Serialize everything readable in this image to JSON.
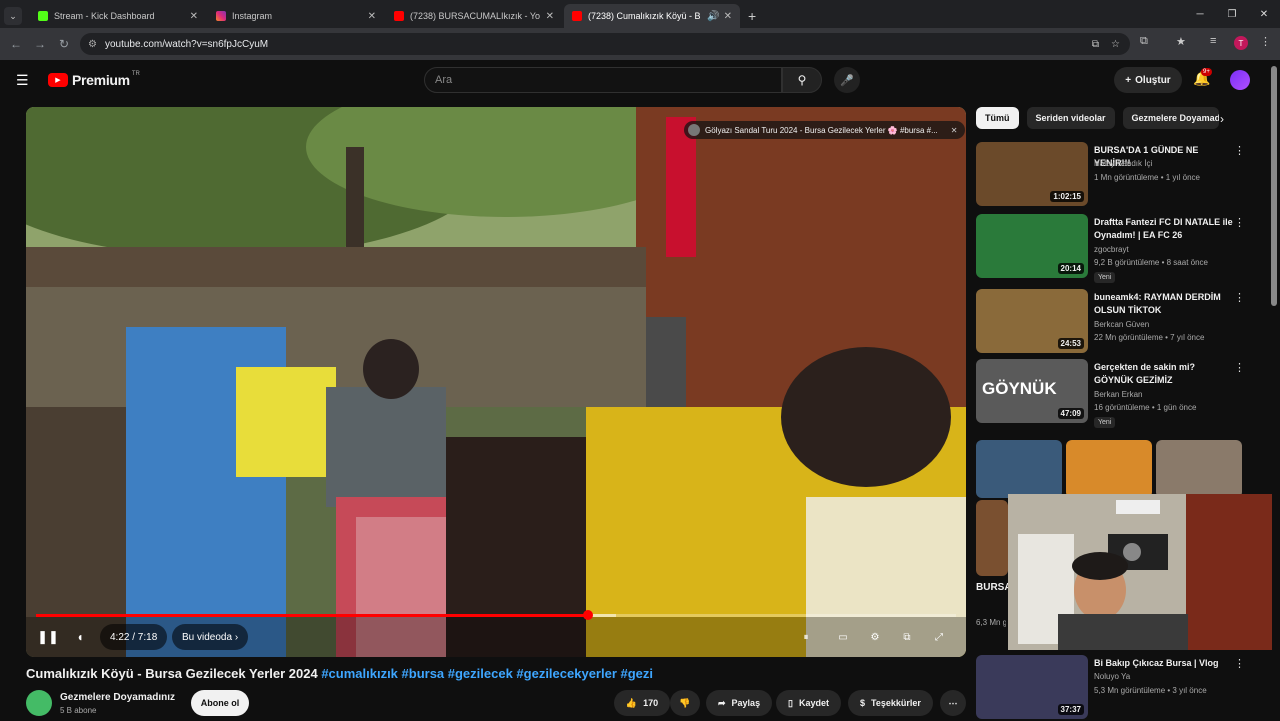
{
  "browser": {
    "tabs": [
      {
        "title": "Stream - Kick Dashboard",
        "icon": "kick-icon",
        "color": "#53fc18"
      },
      {
        "title": "Instagram",
        "icon": "instagram-icon",
        "color": "#e1306c"
      },
      {
        "title": "(7238) BURSACUMALIkızık - Yo",
        "icon": "youtube-icon",
        "color": "#ff0000"
      },
      {
        "title": "(7238) Cumalıkızık Köyü - B",
        "icon": "youtube-icon",
        "color": "#ff0000"
      }
    ],
    "url": "youtube.com/watch?v=sn6fpJcCyuM",
    "profile_letter": "T"
  },
  "youtube": {
    "logo_text": "Premium",
    "logo_sup": "TR",
    "search_placeholder": "Ara",
    "create_label": "Oluştur",
    "notif_count": "9+"
  },
  "player": {
    "playlist_overlay": "Gölyazı Sandal Turu 2024 - Bursa Gezilecek Yerler 🌸 #bursa #...",
    "time": "4:22 / 7:18",
    "chapter": "Bu videoda",
    "progress_fraction": 0.6,
    "buffer_fraction": 0.63
  },
  "video": {
    "title": "Cumalıkızık Köyü - Bursa Gezilecek Yerler 2024",
    "tags": "#cumalıkızık #bursa #gezilecek #gezilecekyerler #gezi",
    "channel": "Gezmelere Doyamadınız",
    "subscribers": "5 B abone",
    "subscribe_label": "Abone ol",
    "likes": "170",
    "share_label": "Paylaş",
    "save_label": "Kaydet",
    "thanks_label": "Teşekkürler"
  },
  "chips": [
    "Tümü",
    "Seriden videolar",
    "Gezmelere Doyamadı"
  ],
  "recommendations": [
    {
      "title": "BURSA'DA 1 GÜNDE NE YENİR!!!",
      "channel": "Hatay Sandık İçi",
      "meta": "1 Mn görüntüleme • 1 yıl önce",
      "duration": "1:02:15",
      "badge": "",
      "thumb": "#6b4a2a"
    },
    {
      "title": "Draftta Fantezi FC DI NATALE ile Oynadım! | EA FC 26",
      "channel": "zgocbrayt",
      "meta": "9,2 B görüntüleme • 8 saat önce",
      "duration": "20:14",
      "badge": "Yeni",
      "thumb": "#2a7a3a"
    },
    {
      "title": "buneamk4: RAYMAN DERDİM OLSUN TİKTOK",
      "channel": "Berkcan Güven",
      "meta": "22 Mn görüntüleme • 7 yıl önce",
      "duration": "24:53",
      "badge": "",
      "thumb": "#8a6a3a"
    },
    {
      "title": "Gerçekten de sakin mi? GÖYNÜK GEZİMİZ",
      "channel": "Berkan Erkan",
      "meta": "16 görüntüleme • 1 gün önce",
      "duration": "47:09",
      "badge": "Yeni",
      "thumb": "#5a5a5a",
      "thumb_text": "GÖYNÜK"
    },
    {
      "title": "Bi Bakıp Çıkıcaz Bursa | Vlog",
      "channel": "Noluyo Ya",
      "meta": "5,3 Mn görüntüleme • 3 yıl önce",
      "duration": "37:37",
      "badge": "",
      "thumb": "#3a3a5a"
    }
  ],
  "partial_rec": {
    "title": "BURSA LEZZE",
    "meta": "6,3 Mn görüntü"
  }
}
